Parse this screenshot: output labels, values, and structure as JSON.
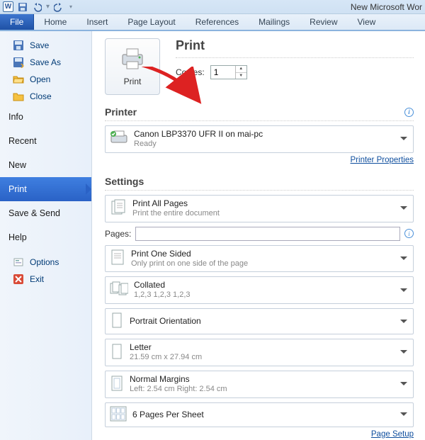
{
  "window": {
    "title": "New Microsoft Wor"
  },
  "qat": {
    "app_letter": "W"
  },
  "ribbon": {
    "file": "File",
    "tabs": [
      "Home",
      "Insert",
      "Page Layout",
      "References",
      "Mailings",
      "Review",
      "View"
    ]
  },
  "sidebar": {
    "save": "Save",
    "save_as": "Save As",
    "open": "Open",
    "close": "Close",
    "info": "Info",
    "recent": "Recent",
    "new": "New",
    "print": "Print",
    "save_send": "Save & Send",
    "help": "Help",
    "options": "Options",
    "exit": "Exit"
  },
  "print": {
    "button_label": "Print",
    "title": "Print",
    "copies_label": "Copies:",
    "copies_value": "1"
  },
  "printer": {
    "section_title": "Printer",
    "name": "Canon LBP3370 UFR II on mai-pc",
    "status": "Ready",
    "properties_link": "Printer Properties"
  },
  "settings": {
    "section_title": "Settings",
    "print_all": {
      "line1": "Print All Pages",
      "line2": "Print the entire document"
    },
    "pages_label": "Pages:",
    "pages_value": "",
    "one_sided": {
      "line1": "Print One Sided",
      "line2": "Only print on one side of the page"
    },
    "collated": {
      "line1": "Collated",
      "line2": "1,2,3   1,2,3   1,2,3"
    },
    "orientation": {
      "line1": "Portrait Orientation"
    },
    "paper": {
      "line1": "Letter",
      "line2": "21.59 cm x 27.94 cm"
    },
    "margins": {
      "line1": "Normal Margins",
      "line2": "Left: 2.54 cm   Right: 2.54 cm"
    },
    "per_sheet": {
      "line1": "6 Pages Per Sheet"
    },
    "page_setup_link": "Page Setup"
  },
  "colors": {
    "accent": "#2a62c6"
  }
}
